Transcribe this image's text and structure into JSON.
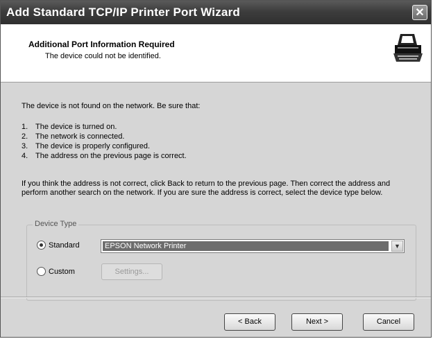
{
  "window": {
    "title": "Add Standard TCP/IP Printer Port Wizard",
    "close_glyph": "✕"
  },
  "header": {
    "title": "Additional Port Information Required",
    "subtitle": "The device could not be identified.",
    "icon": "printer-network-icon"
  },
  "body": {
    "intro": "The device is not found on the network.  Be sure that:",
    "checklist": [
      {
        "num": "1.",
        "text": "The device is turned on."
      },
      {
        "num": "2.",
        "text": "The network is connected."
      },
      {
        "num": "3.",
        "text": "The device is properly configured."
      },
      {
        "num": "4.",
        "text": "The address on the previous page is correct."
      }
    ],
    "paragraph": "If you think the address is not correct, click Back to return to the previous page.  Then correct the address and perform another search on the network.  If you are sure the address is correct, select the device type below."
  },
  "device_type": {
    "legend": "Device Type",
    "standard_label": "Standard",
    "standard_selected": true,
    "standard_value": "EPSON Network Printer",
    "custom_label": "Custom",
    "settings_label": "Settings..."
  },
  "footer": {
    "back_label": "< Back",
    "next_label": "Next >",
    "cancel_label": "Cancel"
  }
}
